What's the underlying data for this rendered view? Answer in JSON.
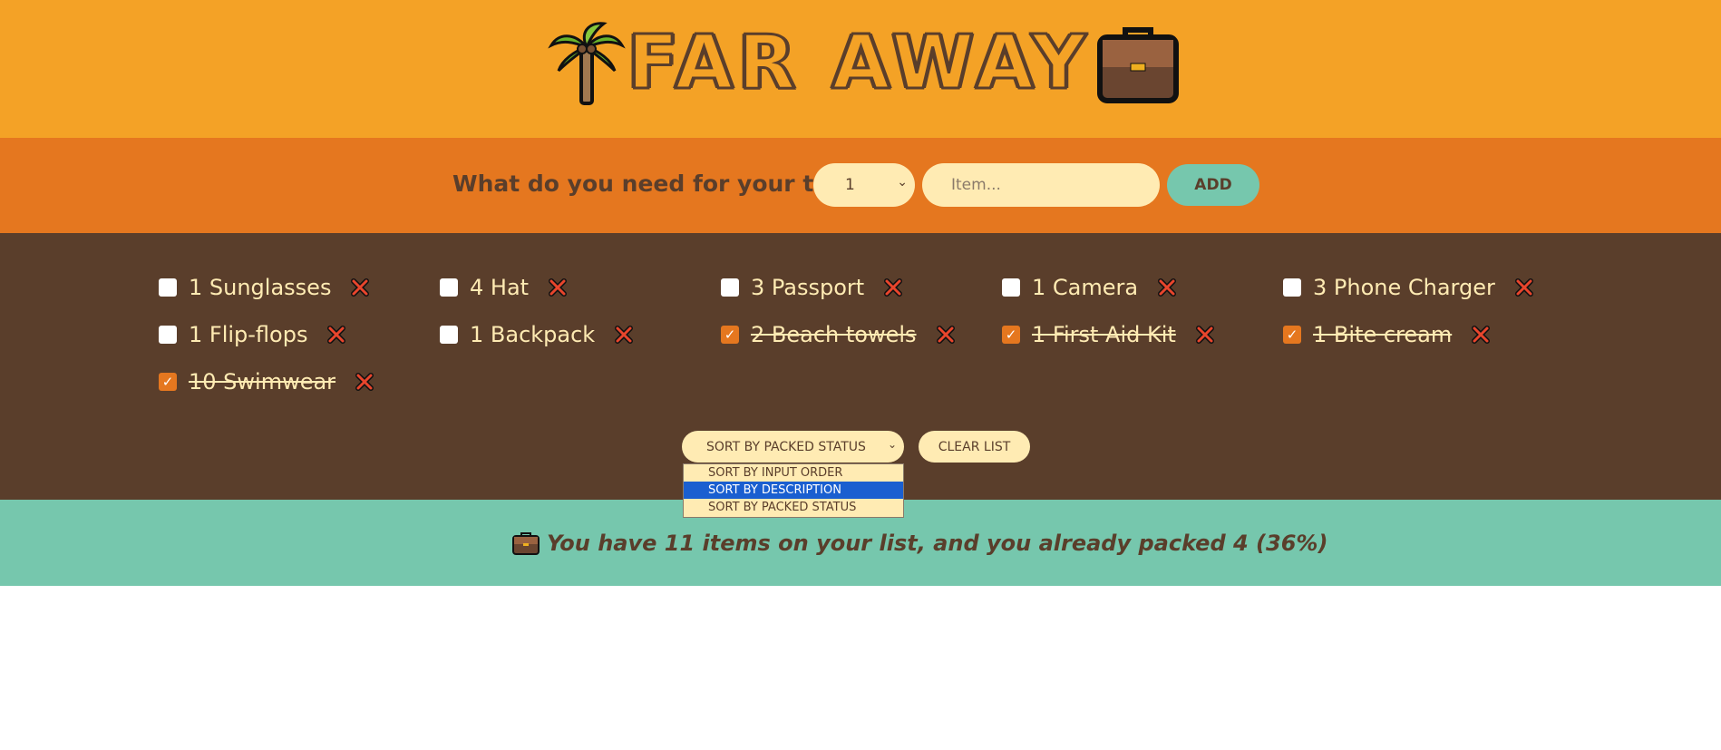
{
  "header": {
    "brand": "FAR AWAY",
    "left_icon": "palm-tree-icon",
    "right_icon": "briefcase-icon"
  },
  "form": {
    "question": "What do you need for your trip?",
    "quantity_value": "1",
    "item_placeholder": "Item...",
    "add_label": "ADD"
  },
  "items": [
    {
      "text": "1 Sunglasses",
      "packed": false
    },
    {
      "text": "4 Hat",
      "packed": false
    },
    {
      "text": "3 Passport",
      "packed": false
    },
    {
      "text": "1 Camera",
      "packed": false
    },
    {
      "text": "3 Phone Charger",
      "packed": false
    },
    {
      "text": "1 Flip-flops",
      "packed": false
    },
    {
      "text": "1 Backpack",
      "packed": false
    },
    {
      "text": "2 Beach towels",
      "packed": true
    },
    {
      "text": "1 First Aid Kit",
      "packed": true
    },
    {
      "text": "1 Bite cream",
      "packed": true
    },
    {
      "text": "10 Swimwear",
      "packed": true
    }
  ],
  "actions": {
    "sort_value": "SORT BY PACKED STATUS",
    "sort_options": [
      "SORT BY INPUT ORDER",
      "SORT BY DESCRIPTION",
      "SORT BY PACKED STATUS"
    ],
    "highlighted_option": "SORT BY DESCRIPTION",
    "clear_label": "CLEAR LIST"
  },
  "stats": {
    "text": "You have 11 items on your list, and you already packed 4 (36%)",
    "icon": "briefcase-icon"
  },
  "colors": {
    "header_bg": "#f4a226",
    "form_bg": "#e5771f",
    "list_bg": "#5a3e2b",
    "stats_bg": "#76c7ad",
    "cream": "#ffebb3"
  }
}
